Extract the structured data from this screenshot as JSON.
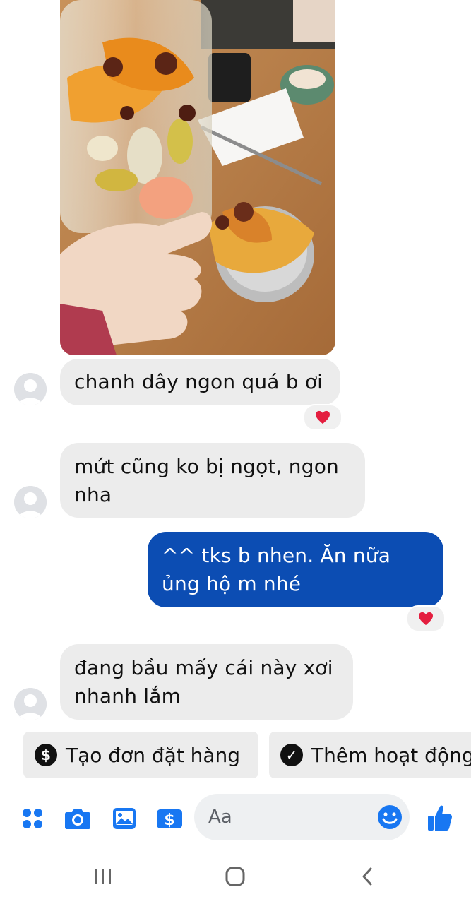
{
  "messages": [
    {
      "side": "in",
      "text": "chanh dây ngon quá b ơi",
      "reaction": "heart"
    },
    {
      "side": "in",
      "text": "mứt cũng ko bị ngọt, ngon nha"
    },
    {
      "side": "out",
      "text": "^^ tks b nhen. Ăn nữa ủng hộ m nhé",
      "reaction": "heart"
    },
    {
      "side": "in",
      "text": "đang bầu mấy cái này xơi nhanh lắm"
    }
  ],
  "quick_actions": {
    "create_order": {
      "icon": "dollar-circle-icon",
      "label": "Tạo đơn đặt hàng"
    },
    "add_activity": {
      "icon": "check-circle-icon",
      "label": "Thêm hoạt động"
    }
  },
  "composer": {
    "placeholder": "Aa",
    "tools": [
      "apps-icon",
      "camera-icon",
      "image-icon",
      "payment-icon"
    ],
    "accent": "#1877f2"
  },
  "colors": {
    "incoming_bubble": "#ececec",
    "outgoing_bubble": "#0c4db3",
    "heart": "#e41e3f"
  },
  "photo": {
    "alt": "photo-message-dried-fruit-jar"
  }
}
